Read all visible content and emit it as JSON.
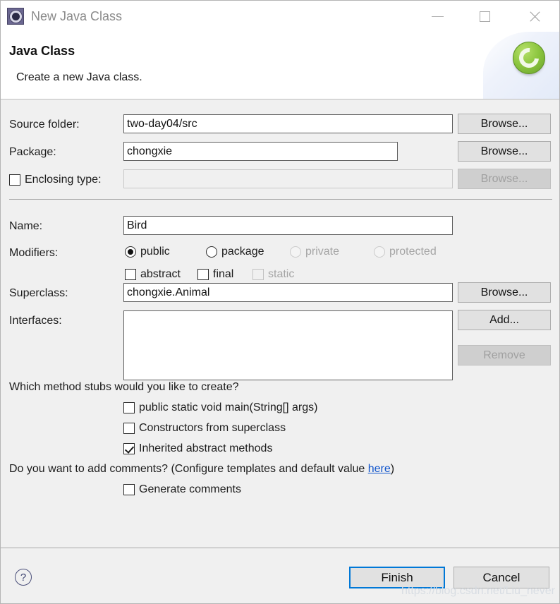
{
  "window": {
    "title": "New Java Class",
    "icon": "java-class-icon",
    "minimize_label": "",
    "maximize_label": "",
    "close_label": ""
  },
  "header": {
    "title": "Java Class",
    "description": "Create a new Java class.",
    "banner_icon": "eclipse-logo-icon"
  },
  "form": {
    "source_folder": {
      "label": "Source folder:",
      "value": "two-day04/src",
      "placeholder": "",
      "browse_label": "Browse...",
      "browse_enabled": true
    },
    "package": {
      "label": "Package:",
      "value": "chongxie",
      "placeholder": "",
      "browse_label": "Browse...",
      "browse_enabled": true
    },
    "enclosing_type": {
      "label": "Enclosing type:",
      "value": "",
      "placeholder": "",
      "checked": false,
      "enabled": false,
      "browse_label": "Browse...",
      "browse_enabled": false
    },
    "name": {
      "label": "Name:",
      "value": "Bird",
      "placeholder": ""
    },
    "modifiers": {
      "label": "Modifiers:",
      "access": [
        {
          "label": "public",
          "checked": true,
          "enabled": true
        },
        {
          "label": "package",
          "checked": false,
          "enabled": true
        },
        {
          "label": "private",
          "checked": false,
          "enabled": false
        },
        {
          "label": "protected",
          "checked": false,
          "enabled": false
        }
      ],
      "flags": [
        {
          "label": "abstract",
          "checked": false,
          "enabled": true
        },
        {
          "label": "final",
          "checked": false,
          "enabled": true
        },
        {
          "label": "static",
          "checked": false,
          "enabled": false
        }
      ]
    },
    "superclass": {
      "label": "Superclass:",
      "value": "chongxie.Animal",
      "placeholder": "",
      "browse_label": "Browse..."
    },
    "interfaces": {
      "label": "Interfaces:",
      "items": [],
      "add_label": "Add...",
      "remove_label": "Remove",
      "remove_enabled": false
    }
  },
  "stubs": {
    "question": "Which method stubs would you like to create?",
    "options": [
      {
        "label": "public static void main(String[] args)",
        "checked": false
      },
      {
        "label": "Constructors from superclass",
        "checked": false
      },
      {
        "label": "Inherited abstract methods",
        "checked": true
      }
    ]
  },
  "comments": {
    "question_prefix": "Do you want to add comments? (Configure templates and default value ",
    "link_label": "here",
    "question_suffix": ")",
    "generate": {
      "label": "Generate comments",
      "checked": false
    }
  },
  "footer": {
    "help_label": "?",
    "finish_label": "Finish",
    "cancel_label": "Cancel",
    "watermark": "https://blog.csdn.net/Liu_never"
  },
  "colors": {
    "accent": "#0078d7",
    "link": "#1155cc",
    "background": "#f0f0f0",
    "eclipse_green": "#8cc63f"
  }
}
